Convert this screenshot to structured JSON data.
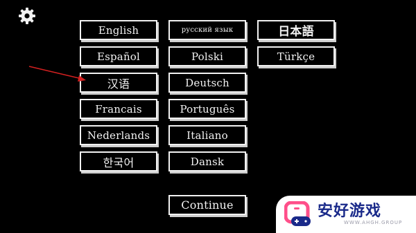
{
  "settings": {
    "icon": "gear-icon"
  },
  "languages": {
    "english": "English",
    "russian": "русский язык",
    "japanese": "日本語",
    "spanish": "Español",
    "polish": "Polski",
    "turkish": "Türkçe",
    "chinese": "汉语",
    "german": "Deutsch",
    "french": "Francais",
    "portuguese": "Português",
    "dutch": "Nederlands",
    "italian": "Italiano",
    "korean": "한국어",
    "danish": "Dansk"
  },
  "continue_label": "Continue",
  "annotation": {
    "arrow_color": "#d42020"
  },
  "watermark": {
    "title": "安好游戏",
    "subtitle": "WWW.AHGH.GROUP",
    "brand_color": "#1a2a8a",
    "accent_color": "#ff4f8a"
  }
}
